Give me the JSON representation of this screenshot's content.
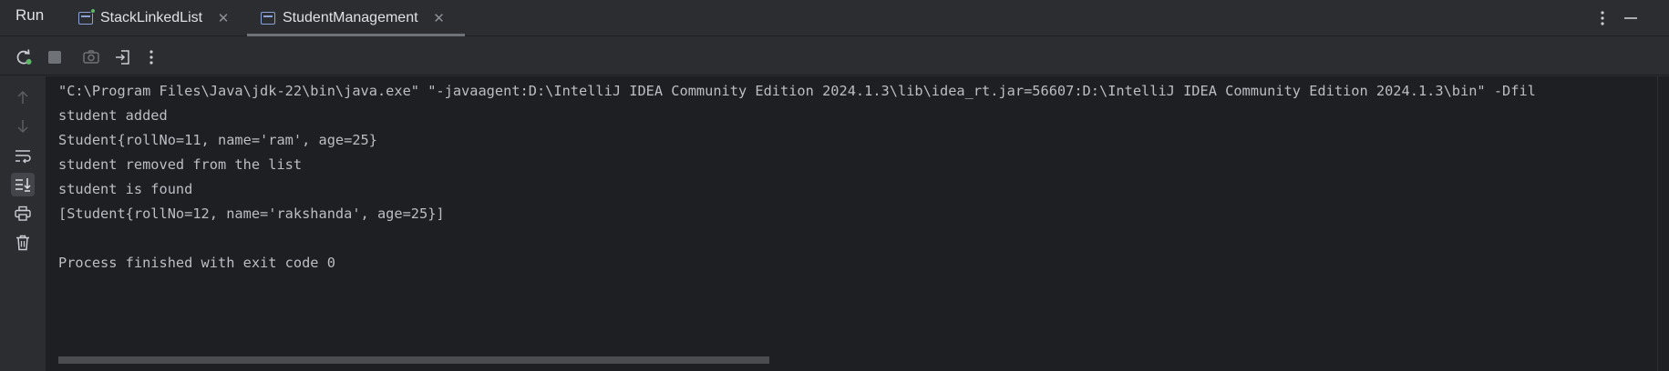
{
  "header": {
    "title": "Run",
    "tabs": [
      {
        "label": "StackLinkedList",
        "close": "✕"
      },
      {
        "label": "StudentManagement",
        "close": "✕"
      }
    ],
    "more_icon": "vertical-dots-icon",
    "minimize_icon": "minimize-icon"
  },
  "toolbar": {
    "buttons": [
      "rerun-icon",
      "stop-icon",
      "camera-icon",
      "exit-icon",
      "more-icon"
    ]
  },
  "gutter": {
    "buttons": [
      "arrow-up-icon",
      "arrow-down-icon",
      "soft-wrap-icon",
      "scroll-to-end-icon",
      "print-icon",
      "trash-icon"
    ]
  },
  "console": {
    "lines": [
      "\"C:\\Program Files\\Java\\jdk-22\\bin\\java.exe\" \"-javaagent:D:\\IntelliJ IDEA Community Edition 2024.1.3\\lib\\idea_rt.jar=56607:D:\\IntelliJ IDEA Community Edition 2024.1.3\\bin\" -Dfil",
      "student added",
      "Student{rollNo=11, name='ram', age=25}",
      "student removed from the list",
      "student is found",
      "[Student{rollNo=12, name='rakshanda', age=25}]",
      "",
      "Process finished with exit code 0"
    ]
  },
  "colors": {
    "background": "#1e1f22",
    "panel": "#2b2d30",
    "text": "#bcbec4",
    "accent_green": "#5fb865"
  }
}
